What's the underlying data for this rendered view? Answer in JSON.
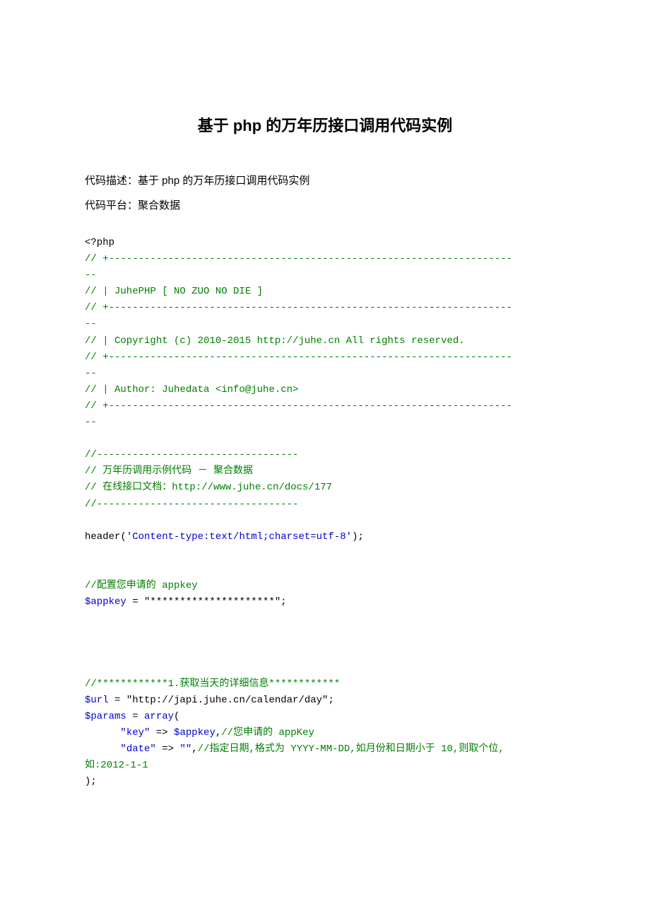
{
  "title": "基于 php 的万年历接口调用代码实例",
  "meta1": "代码描述：基于 php 的万年历接口调用代码实例",
  "meta2": "代码平台：聚合数据",
  "code": {
    "php_open": "<?php",
    "sep1a": "// +--------------------------------------------------------------------",
    "sep1b": "--",
    "hdr1": "// | JuhePHP [ NO ZUO NO DIE ]",
    "sep2a": "// +--------------------------------------------------------------------",
    "sep2b": "--",
    "hdr2": "// | Copyright (c) 2010-2015 http://juhe.cn All rights reserved.",
    "sep3a": "// +--------------------------------------------------------------------",
    "sep3b": "--",
    "hdr3": "// | Author: Juhedata <info@juhe.cn>",
    "sep4a": "// +--------------------------------------------------------------------",
    "sep4b": "--",
    "dash1": "//----------------------------------",
    "cmt1": "// 万年历调用示例代码 － 聚合数据",
    "cmt2": "// 在线接口文档：http://www.juhe.cn/docs/177",
    "dash2": "//----------------------------------",
    "header_fn": "header(",
    "header_str": "'Content-type:text/html;charset=utf-8'",
    "header_end": ");",
    "cmt_appkey_pre": "//",
    "cmt_appkey_txt": "配置您申请的",
    "cmt_appkey_suf": " appkey",
    "appkey_var": "$appkey",
    "appkey_val": " = \"*********************\";",
    "cmt_sec1_pre": "//************1.",
    "cmt_sec1_mid": "获取当天的详细信息",
    "cmt_sec1_suf": "************",
    "url_var": "$url",
    "url_val": " = \"http://japi.juhe.cn/calendar/day\";",
    "params_var": "$params",
    "params_eq": " = ",
    "array_fn": "array",
    "paren_open": "(",
    "key_str": "      \"key\"",
    "arrow": " => ",
    "appkey_ref": "$appkey",
    "comma": ",",
    "key_cmt_pre": "//",
    "key_cmt_txt": "您申请的",
    "key_cmt_suf": " appKey",
    "date_str": "      \"date\"",
    "date_val": "\"\"",
    "date_cmt_pre": "//",
    "date_cmt1": "指定日期,格式为",
    "date_cmt2": " YYYY-MM-DD,",
    "date_cmt3": "如月份和日期小于",
    "date_cmt4": " 10,",
    "date_cmt5": "则取个位,",
    "date_cmt6": "如",
    "date_cmt7": ":2012-1-1",
    "close": ");"
  }
}
